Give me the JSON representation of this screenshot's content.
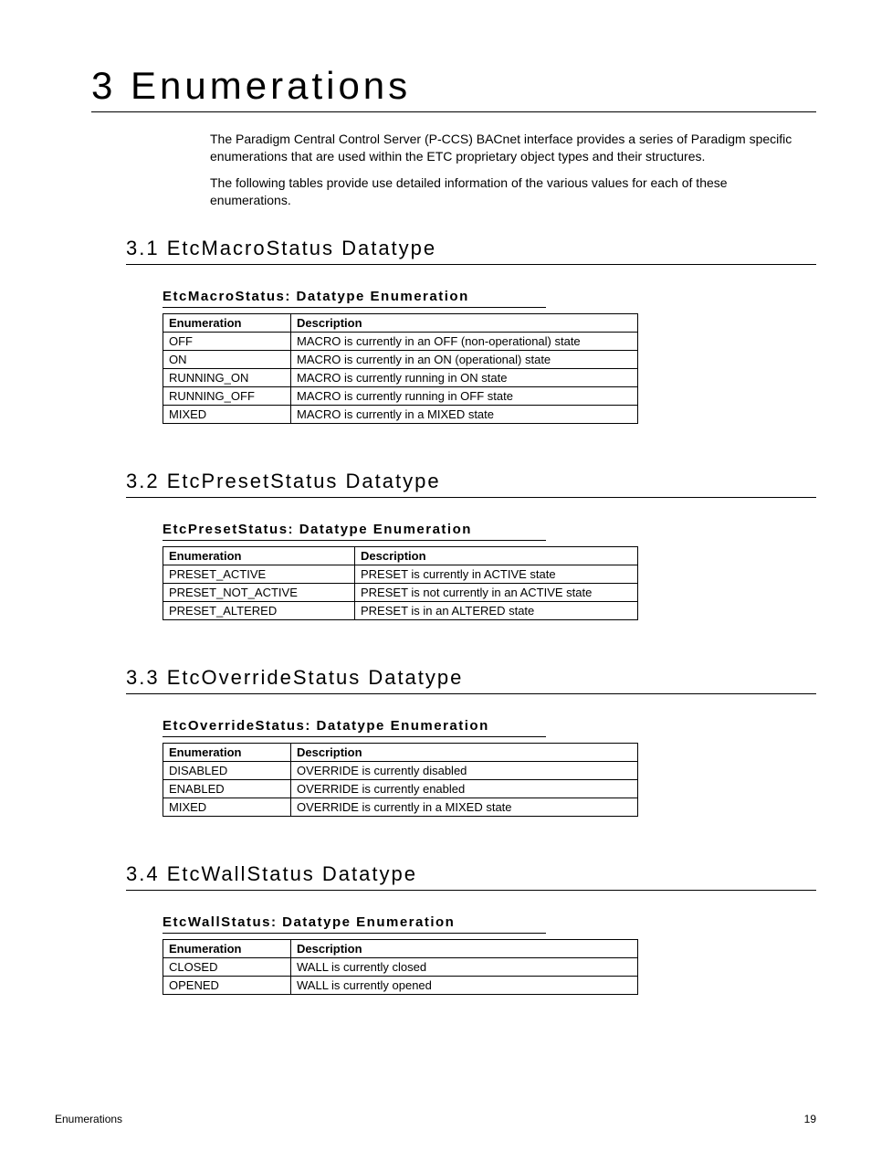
{
  "chapter": {
    "title": "3 Enumerations"
  },
  "intro": {
    "p1": "The Paradigm Central Control Server (P-CCS) BACnet interface provides a series of Paradigm specific enumerations that are used within the ETC proprietary object types and their structures.",
    "p2": "The following tables provide use detailed information of the various values for each of these enumerations."
  },
  "sections": {
    "s1": {
      "title": "3.1 EtcMacroStatus Datatype",
      "subtitle": "EtcMacroStatus: Datatype Enumeration",
      "headers": {
        "col1": "Enumeration",
        "col2": "Description"
      },
      "rows": [
        {
          "c1": "OFF",
          "c2": "MACRO is currently in an OFF (non-operational) state"
        },
        {
          "c1": "ON",
          "c2": "MACRO is currently in an ON (operational) state"
        },
        {
          "c1": "RUNNING_ON",
          "c2": "MACRO is currently running in ON state"
        },
        {
          "c1": "RUNNING_OFF",
          "c2": "MACRO is currently running in OFF state"
        },
        {
          "c1": "MIXED",
          "c2": "MACRO is currently in a MIXED state"
        }
      ]
    },
    "s2": {
      "title": "3.2 EtcPresetStatus Datatype",
      "subtitle": "EtcPresetStatus: Datatype Enumeration",
      "headers": {
        "col1": "Enumeration",
        "col2": "Description"
      },
      "rows": [
        {
          "c1": "PRESET_ACTIVE",
          "c2": "PRESET is currently in ACTIVE state"
        },
        {
          "c1": "PRESET_NOT_ACTIVE",
          "c2": "PRESET is not currently in an ACTIVE state"
        },
        {
          "c1": "PRESET_ALTERED",
          "c2": "PRESET is in an ALTERED state"
        }
      ]
    },
    "s3": {
      "title": "3.3 EtcOverrideStatus Datatype",
      "subtitle": "EtcOverrideStatus: Datatype Enumeration",
      "headers": {
        "col1": "Enumeration",
        "col2": "Description"
      },
      "rows": [
        {
          "c1": "DISABLED",
          "c2": "OVERRIDE is currently disabled"
        },
        {
          "c1": "ENABLED",
          "c2": "OVERRIDE is currently enabled"
        },
        {
          "c1": "MIXED",
          "c2": "OVERRIDE is currently in a MIXED state"
        }
      ]
    },
    "s4": {
      "title": "3.4 EtcWallStatus Datatype",
      "subtitle": "EtcWallStatus: Datatype Enumeration",
      "headers": {
        "col1": "Enumeration",
        "col2": "Description"
      },
      "rows": [
        {
          "c1": "CLOSED",
          "c2": "WALL is currently closed"
        },
        {
          "c1": "OPENED",
          "c2": "WALL is currently opened"
        }
      ]
    }
  },
  "footer": {
    "left": "Enumerations",
    "right": "19"
  },
  "tableWidths": {
    "s1": {
      "c1": "140px",
      "c2": "380px"
    },
    "s2": {
      "c1": "210px",
      "c2": "310px"
    },
    "s3": {
      "c1": "140px",
      "c2": "380px"
    },
    "s4": {
      "c1": "140px",
      "c2": "380px"
    }
  }
}
